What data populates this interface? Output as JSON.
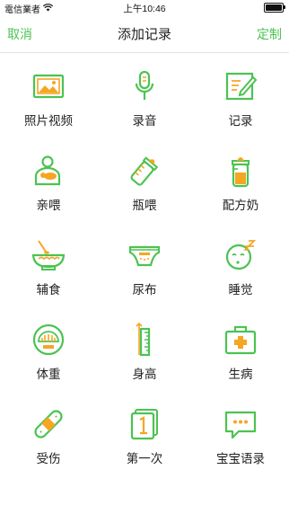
{
  "status_bar": {
    "carrier": "電信業者",
    "time": "上午10:46"
  },
  "nav": {
    "left_label": "取消",
    "title": "添加记录",
    "right_label": "定制"
  },
  "colors": {
    "accent": "#4cc352",
    "icon_orange": "#f5a623"
  },
  "items": [
    {
      "label": "照片视频",
      "icon": "photo-icon"
    },
    {
      "label": "录音",
      "icon": "microphone-icon"
    },
    {
      "label": "记录",
      "icon": "note-icon"
    },
    {
      "label": "亲喂",
      "icon": "breastfeed-icon"
    },
    {
      "label": "瓶喂",
      "icon": "baby-bottle-icon"
    },
    {
      "label": "配方奶",
      "icon": "formula-bottle-icon"
    },
    {
      "label": "辅食",
      "icon": "food-bowl-icon"
    },
    {
      "label": "尿布",
      "icon": "diaper-icon"
    },
    {
      "label": "睡觉",
      "icon": "sleep-icon"
    },
    {
      "label": "体重",
      "icon": "scale-icon"
    },
    {
      "label": "身高",
      "icon": "ruler-icon"
    },
    {
      "label": "生病",
      "icon": "medical-kit-icon"
    },
    {
      "label": "受伤",
      "icon": "bandage-icon"
    },
    {
      "label": "第一次",
      "icon": "first-time-icon"
    },
    {
      "label": "宝宝语录",
      "icon": "speech-bubble-icon"
    }
  ]
}
